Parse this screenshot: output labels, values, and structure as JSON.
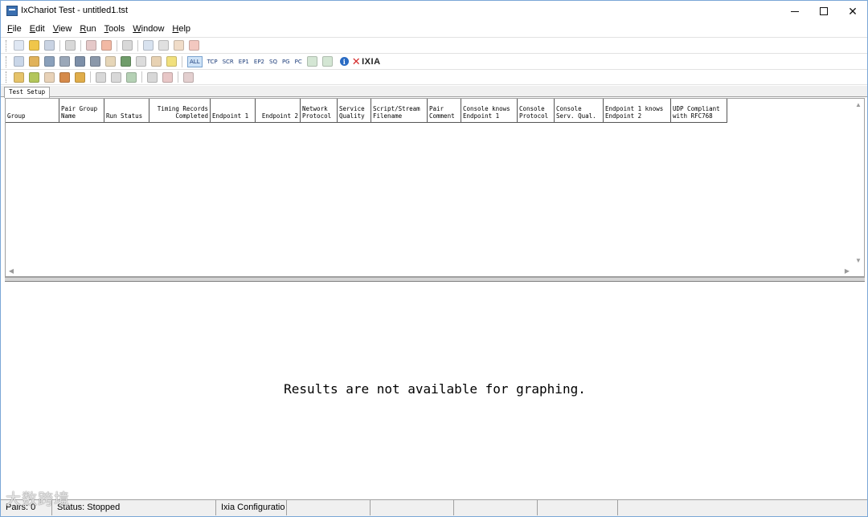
{
  "window": {
    "title": "IxChariot Test - untitled1.tst",
    "minimize_glyph": "—",
    "close_glyph": "✕"
  },
  "menu": [
    {
      "accel": "F",
      "rest": "ile"
    },
    {
      "accel": "E",
      "rest": "dit"
    },
    {
      "accel": "V",
      "rest": "iew"
    },
    {
      "accel": "R",
      "rest": "un"
    },
    {
      "accel": "T",
      "rest": "ools"
    },
    {
      "accel": "W",
      "rest": "indow"
    },
    {
      "accel": "H",
      "rest": "elp"
    }
  ],
  "toolbar1": {
    "icons": [
      {
        "name": "new-icon",
        "color": "#dfe7f3"
      },
      {
        "name": "open-icon",
        "color": "#f0c64a"
      },
      {
        "name": "save-icon",
        "color": "#c9d3e3"
      },
      {
        "sep": true
      },
      {
        "name": "print-icon",
        "color": "#d8d8d8"
      },
      {
        "sep": true
      },
      {
        "name": "run-icon",
        "color": "#e5c8c8"
      },
      {
        "name": "stop-icon",
        "color": "#f2b9a4"
      },
      {
        "sep": true
      },
      {
        "name": "mark-icon",
        "color": "#d8d8d8"
      },
      {
        "sep": true
      },
      {
        "name": "add-icon",
        "color": "#d8e2ef"
      },
      {
        "name": "copy-icon",
        "color": "#e0e0e0"
      },
      {
        "name": "cut-icon",
        "color": "#f0dcc8"
      },
      {
        "name": "paste-icon",
        "color": "#f3c8c0"
      }
    ]
  },
  "toolbar2": {
    "icons": [
      {
        "name": "add-pair-icon",
        "color": "#c9d6e8"
      },
      {
        "name": "add-multicast-icon",
        "color": "#e0b25a"
      },
      {
        "name": "edit-pair-icon",
        "color": "#8aa0bb"
      },
      {
        "name": "hardware-pair-icon",
        "color": "#9aa7b8"
      },
      {
        "name": "voip-pair-icon",
        "color": "#7d8fa8"
      },
      {
        "name": "video-pair-icon",
        "color": "#8b98aa"
      },
      {
        "name": "edit-script-icon",
        "color": "#e6d6b8"
      },
      {
        "name": "network-icon",
        "color": "#6f9c6a"
      },
      {
        "name": "delete-icon",
        "color": "#dcdcdc"
      },
      {
        "name": "replicate-icon",
        "color": "#e8d2b3"
      },
      {
        "name": "warning-icon",
        "color": "#f1e07d"
      }
    ],
    "protocols": [
      "ALL",
      "TCP",
      "SCR",
      "EP1",
      "EP2",
      "SQ",
      "PG",
      "PC"
    ],
    "brand": "IXIA"
  },
  "toolbar3": {
    "icons": [
      {
        "name": "clock-icon",
        "color": "#e6c36a"
      },
      {
        "name": "flag-icon",
        "color": "#b3c65b"
      },
      {
        "name": "filter-icon",
        "color": "#e8d2b8"
      },
      {
        "name": "topology-icon",
        "color": "#d58a4a"
      },
      {
        "name": "cube-icon",
        "color": "#e0ad4a"
      },
      {
        "sep": true
      },
      {
        "name": "expand-icon",
        "color": "#d8d8d8"
      },
      {
        "name": "collapse-icon",
        "color": "#d8d8d8"
      },
      {
        "name": "sort-icon",
        "color": "#b5d1b5"
      },
      {
        "sep": true
      },
      {
        "name": "group-icon",
        "color": "#d8d8d8"
      },
      {
        "name": "ungroup-icon",
        "color": "#e8c7c7"
      },
      {
        "sep": true
      },
      {
        "name": "report-icon",
        "color": "#e3cfcf"
      }
    ]
  },
  "tabs": [
    "Test Setup"
  ],
  "grid": {
    "columns": [
      {
        "label": "Group",
        "align": "left"
      },
      {
        "label": "Pair Group\nName",
        "align": "left"
      },
      {
        "label": "Run Status",
        "align": "left"
      },
      {
        "label": "Timing Records\nCompleted",
        "align": "right"
      },
      {
        "label": "Endpoint 1",
        "align": "left"
      },
      {
        "label": "Endpoint 2",
        "align": "right"
      },
      {
        "label": "Network\nProtocol",
        "align": "left"
      },
      {
        "label": "Service\nQuality",
        "align": "left"
      },
      {
        "label": "Script/Stream\nFilename",
        "align": "left"
      },
      {
        "label": "Pair\nComment",
        "align": "left"
      },
      {
        "label": "Console knows\nEndpoint 1",
        "align": "left"
      },
      {
        "label": "Console\nProtocol",
        "align": "left"
      },
      {
        "label": "Console\nServ. Qual.",
        "align": "left"
      },
      {
        "label": "Endpoint 1 knows\nEndpoint 2",
        "align": "left"
      },
      {
        "label": "UDP Compliant\nwith RFC768",
        "align": "left"
      }
    ]
  },
  "graph": {
    "message": "Results are not available for graphing."
  },
  "statusbar": [
    "Pairs: 0",
    "Status: Stopped",
    "Ixia Configuratio",
    "",
    "",
    "",
    ""
  ],
  "watermark": "大数跨境"
}
